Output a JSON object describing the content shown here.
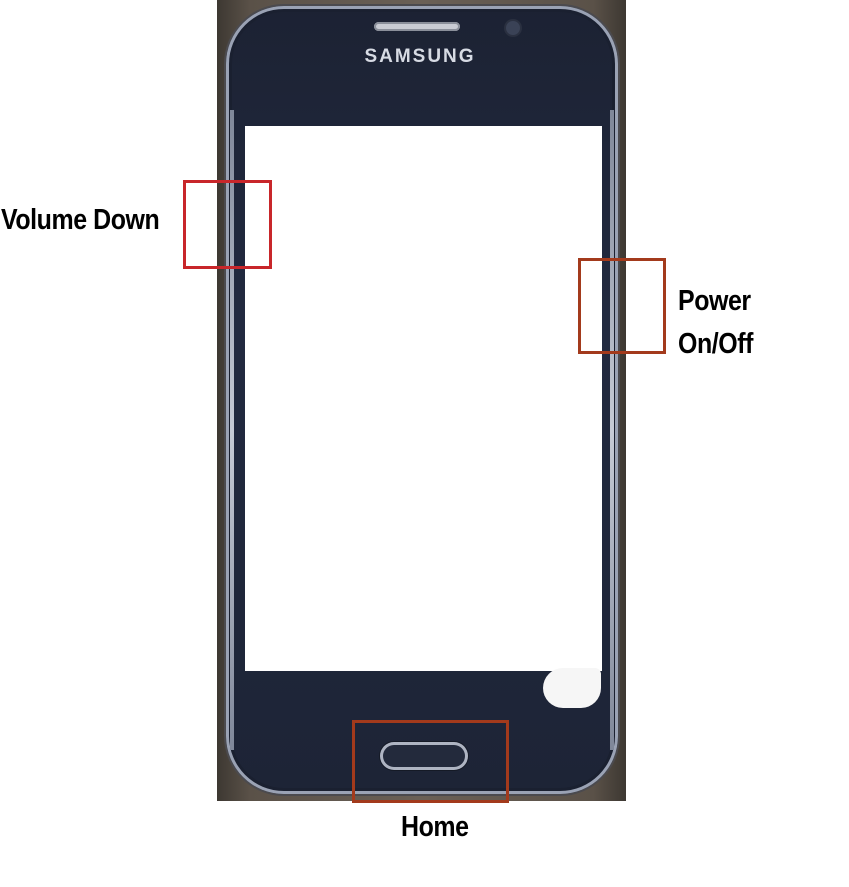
{
  "phone": {
    "brand": "SAMSUNG"
  },
  "callouts": {
    "volume_down": "Volume Down",
    "power_line1": "Power",
    "power_line2": "On/Off",
    "home": "Home"
  },
  "colors": {
    "callout_red": "#c8262a",
    "callout_brown": "#a33a1c",
    "phone_body": "#1c2233",
    "screen": "#ffffff"
  }
}
